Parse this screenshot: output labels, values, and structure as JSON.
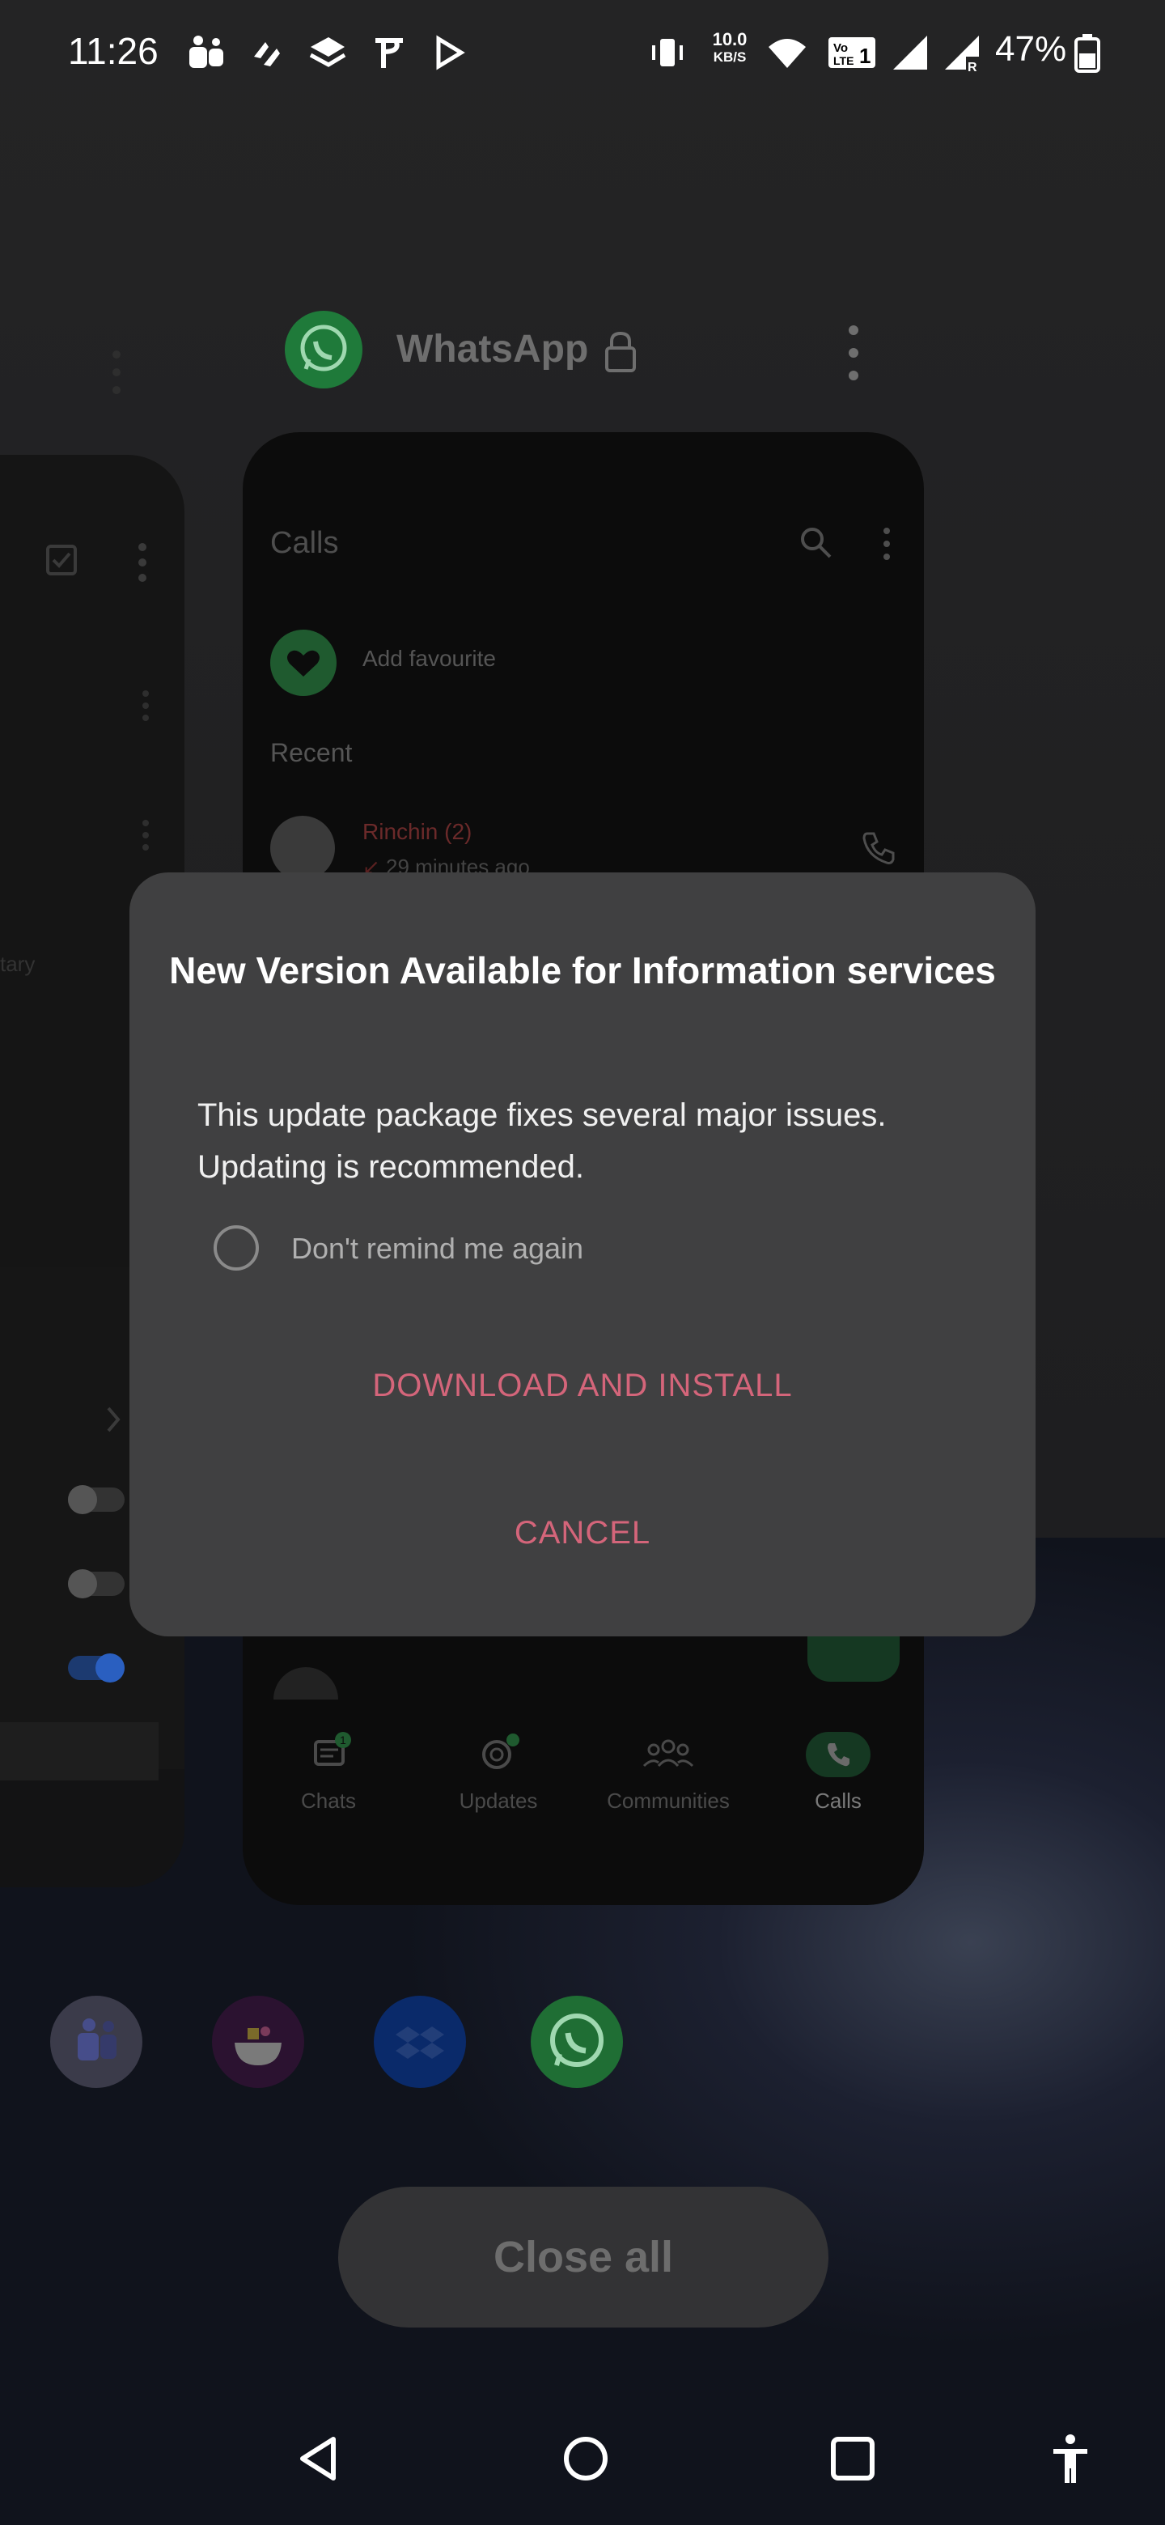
{
  "status_bar": {
    "time": "11:26",
    "battery": "47%",
    "net_speed_value": "10.0",
    "net_speed_unit": "KB/S"
  },
  "app_header": {
    "name": "WhatsApp"
  },
  "calls_card": {
    "title": "Calls",
    "add_favourite": "Add favourite",
    "recent_label": "Recent",
    "recent_item": {
      "name": "Rinchin (2)",
      "time": "29 minutes ago"
    },
    "nav": [
      {
        "label": "Chats",
        "badge": "1"
      },
      {
        "label": "Updates"
      },
      {
        "label": "Communities"
      },
      {
        "label": "Calls"
      }
    ]
  },
  "left_card": {
    "partial_text": "tary"
  },
  "dialog": {
    "title": "New Version Available for Information services",
    "body": "This update package fixes several major issues. Updating is recommended.",
    "checkbox_label": "Don't remind me again",
    "download_button": "DOWNLOAD AND INSTALL",
    "cancel_button": "CANCEL"
  },
  "close_all": "Close all",
  "colors": {
    "accent": "#d4657a",
    "whatsapp_green": "#25d366",
    "dialog_bg": "#404041"
  }
}
